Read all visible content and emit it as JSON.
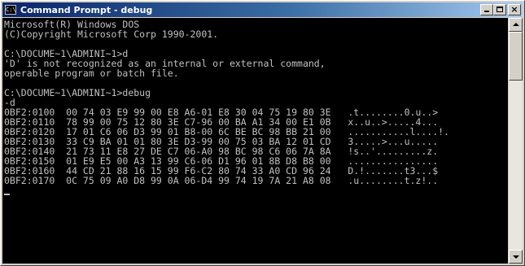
{
  "window": {
    "title": "Command Prompt - debug",
    "icon_label": "C:\\",
    "buttons": {
      "minimize": "minimize-icon",
      "maximize": "maximize-icon",
      "close": "close-icon",
      "close_glyph": "×"
    }
  },
  "console": {
    "text_color": "#c0c0c0",
    "background": "#000000",
    "lines": [
      "Microsoft(R) Windows DOS",
      "(C)Copyright Microsoft Corp 1990-2001.",
      "",
      "C:\\DOCUME~1\\ADMINI~1>d",
      "'D' is not recognized as an internal or external command,",
      "operable program or batch file.",
      "",
      "C:\\DOCUME~1\\ADMINI~1>debug",
      "-d",
      "0BF2:0100  00 74 03 E9 99 00 E8 A6-01 E8 30 04 75 19 80 3E   .t........0.u..>",
      "0BF2:0110  78 99 00 75 12 80 3E C7-96 00 BA A1 34 00 E1 0B   x..u..>.....4...",
      "0BF2:0120  17 01 C6 06 D3 99 01 B8-00 6C BE BC 98 BB 21 00   ...........l....!.",
      "0BF2:0130  33 C9 BA 01 01 80 3E D3-99 00 75 03 BA 12 01 CD   3.....>...u.....",
      "0BF2:0140  21 73 11 E8 27 DE C7 06-A0 98 BC 98 C6 06 7A 8A   !s..'.........z.",
      "0BF2:0150  01 E9 E5 00 A3 13 99 C6-06 D1 96 01 8B D8 B8 00   ................",
      "0BF2:0160  44 CD 21 88 16 15 99 F6-C2 80 74 33 A0 CD 96 24   D.!.......t3...$",
      "0BF2:0170  0C 75 09 A0 D8 99 0A 06-D4 99 74 19 7A 21 A8 08   .u........t.z!.."
    ],
    "cursor_prompt": "-"
  }
}
